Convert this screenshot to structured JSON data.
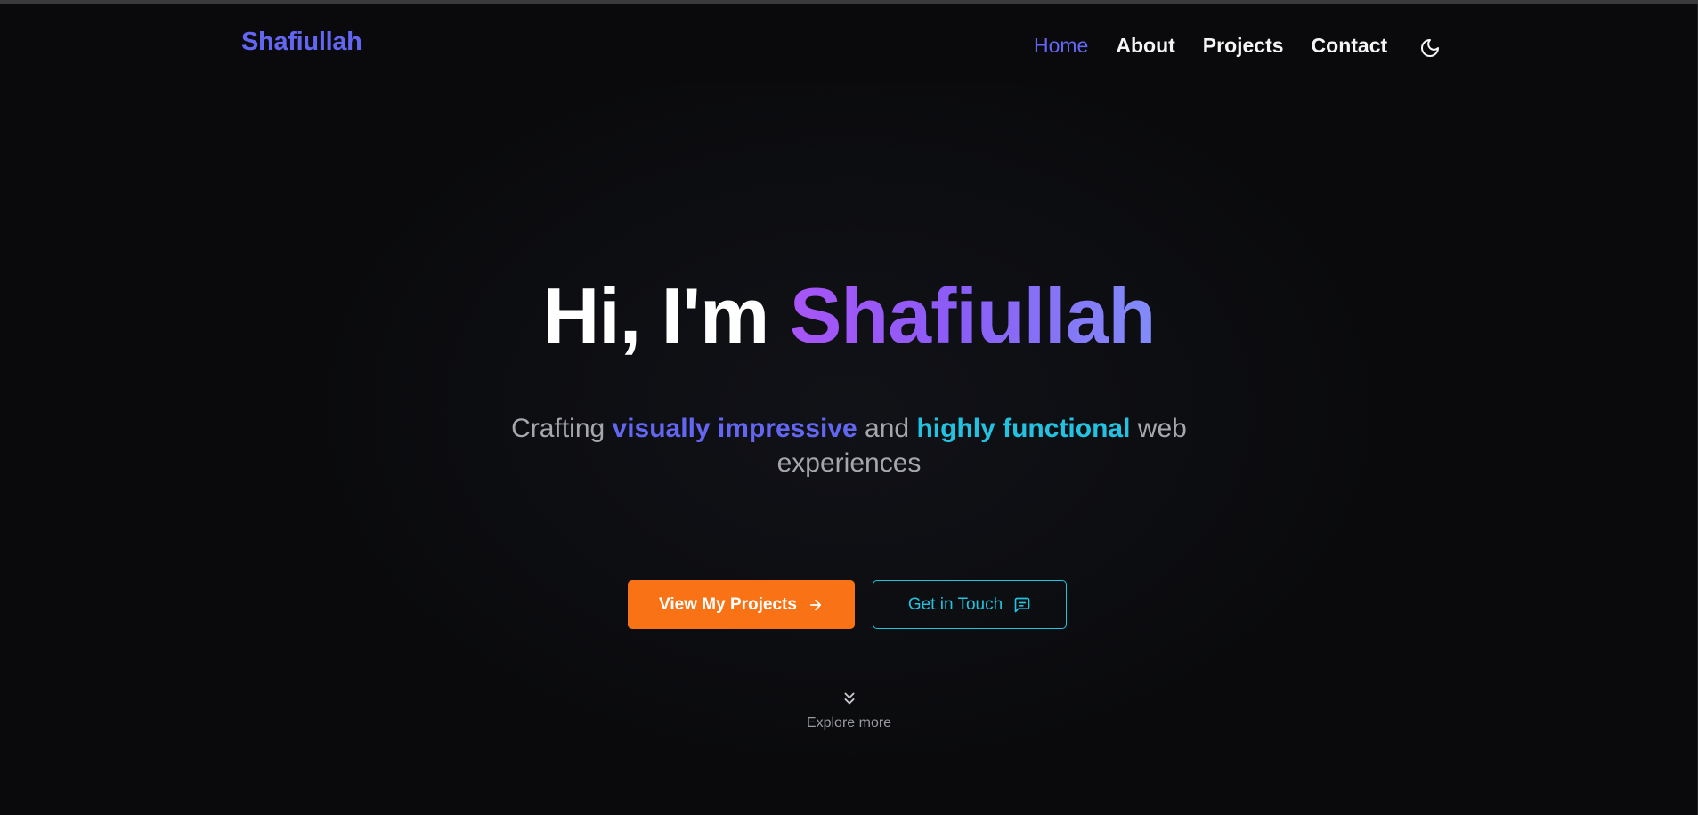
{
  "navbar": {
    "brand": "Shafiullah",
    "links": [
      {
        "label": "Home",
        "active": true
      },
      {
        "label": "About",
        "active": false
      },
      {
        "label": "Projects",
        "active": false
      },
      {
        "label": "Contact",
        "active": false
      }
    ],
    "theme_toggle_icon": "moon-icon"
  },
  "hero": {
    "greeting": "Hi, I'm",
    "name": "Shafiullah",
    "subtitle_parts": {
      "p1": "Crafting",
      "h1": "visually impressive",
      "p2": "and",
      "h2": "highly functional",
      "p3": "web",
      "p4": "experiences"
    }
  },
  "buttons": {
    "primary_label": "View My Projects",
    "primary_icon": "arrow-right-icon",
    "secondary_label": "Get in Touch",
    "secondary_icon": "message-square-icon"
  },
  "explore": {
    "icon": "chevrons-down-icon",
    "label": "Explore more"
  },
  "colors": {
    "accent": "#6366f1",
    "orange": "#f97316",
    "cyan": "#22c2e0",
    "gradient_start": "#a855f7",
    "gradient_end": "#818cf8",
    "background": "#0a0a0c"
  }
}
